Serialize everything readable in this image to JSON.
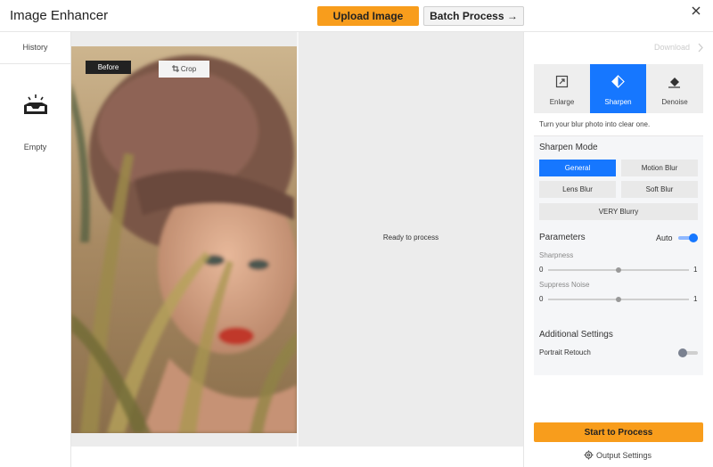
{
  "header": {
    "app_title": "Image Enhancer",
    "upload_label": "Upload Image",
    "batch_label": "Batch Process →",
    "close_icon": "close-icon"
  },
  "history": {
    "title": "History",
    "empty_label": "Empty",
    "icon": "empty-tray-icon"
  },
  "canvas": {
    "before_label": "Before",
    "crop_label": "Crop",
    "ready_text": "Ready to process",
    "image": "portrait-of-woman-behind-grass"
  },
  "panel": {
    "download_label": "Download",
    "tabs": [
      {
        "label": "Enlarge",
        "icon": "enlarge-icon",
        "active": false
      },
      {
        "label": "Sharpen",
        "icon": "sharpen-icon",
        "active": true
      },
      {
        "label": "Denoise",
        "icon": "eraser-icon",
        "active": false
      }
    ],
    "description": "Turn your blur photo into clear one.",
    "sharpen_mode_title": "Sharpen Mode",
    "modes": [
      "General",
      "Motion Blur",
      "Lens Blur",
      "Soft Blur",
      "VERY Blurry"
    ],
    "selected_mode": "General",
    "parameters_title": "Parameters",
    "auto_label": "Auto",
    "auto_enabled": true,
    "sharpness": {
      "label": "Sharpness",
      "min": "0",
      "max": "1",
      "value": 0.5
    },
    "suppress_noise": {
      "label": "Suppress Noise",
      "min": "0",
      "max": "1",
      "value": 0.5
    },
    "additional_title": "Additional Settings",
    "portrait_retouch_label": "Portrait Retouch",
    "portrait_retouch_enabled": false,
    "start_label": "Start to Process",
    "output_settings_label": "Output Settings"
  },
  "colors": {
    "accent_orange": "#f89d1c",
    "active_blue": "#1677ff"
  }
}
